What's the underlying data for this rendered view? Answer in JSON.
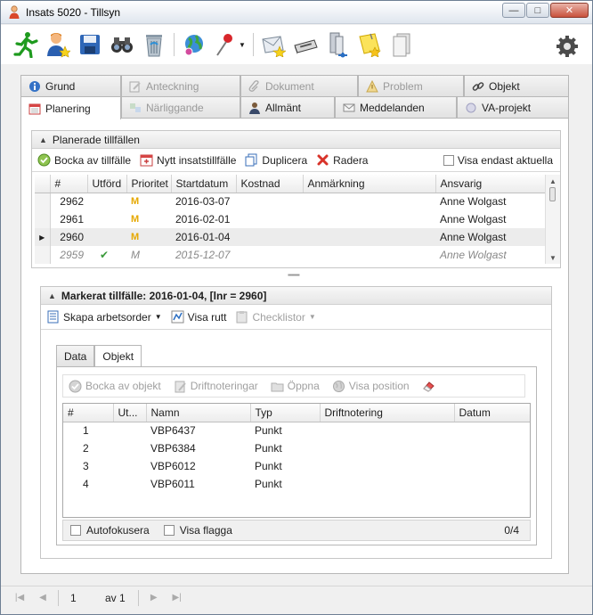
{
  "window": {
    "title": "Insats 5020 - Tillsyn",
    "min": "—",
    "max": "□",
    "close": "✕"
  },
  "tabs_row1": [
    {
      "label": "Grund",
      "enabled": true
    },
    {
      "label": "Anteckning",
      "enabled": false
    },
    {
      "label": "Dokument",
      "enabled": false
    },
    {
      "label": "Problem",
      "enabled": false
    },
    {
      "label": "Objekt",
      "enabled": true
    }
  ],
  "tabs_row2": [
    {
      "label": "Planering",
      "enabled": true,
      "active": true
    },
    {
      "label": "Närliggande",
      "enabled": false
    },
    {
      "label": "Allmänt",
      "enabled": true
    },
    {
      "label": "Meddelanden",
      "enabled": true
    },
    {
      "label": "VA-projekt",
      "enabled": true
    }
  ],
  "planned": {
    "header": "Planerade tillfällen",
    "actions": {
      "tick": "Bocka av tillfälle",
      "new": "Nytt insatstillfälle",
      "duplicate": "Duplicera",
      "delete": "Radera",
      "show_current": "Visa endast aktuella"
    },
    "columns": [
      "#",
      "Utförd",
      "Prioritet",
      "Startdatum",
      "Kostnad",
      "Anmärkning",
      "Ansvarig"
    ],
    "rows": [
      {
        "id": "2962",
        "done": "",
        "prio": "M",
        "start": "2016-03-07",
        "cost": "",
        "note": "",
        "resp": "Anne Wolgast"
      },
      {
        "id": "2961",
        "done": "",
        "prio": "M",
        "start": "2016-02-01",
        "cost": "",
        "note": "",
        "resp": "Anne Wolgast"
      },
      {
        "id": "2960",
        "done": "",
        "prio": "M",
        "start": "2016-01-04",
        "cost": "",
        "note": "",
        "resp": "Anne Wolgast"
      },
      {
        "id": "2959",
        "done": "✔",
        "prio": "M",
        "start": "2015-12-07",
        "cost": "",
        "note": "",
        "resp": "Anne Wolgast"
      }
    ]
  },
  "marked": {
    "header": "Markerat tillfälle: 2016-01-04, [lnr = 2960]",
    "actions": {
      "work_order": "Skapa arbetsorder",
      "show_route": "Visa rutt",
      "checklists": "Checklistor"
    },
    "tabs": [
      "Data",
      "Objekt"
    ],
    "obj_actions": {
      "tick_object": "Bocka av objekt",
      "operation_notes": "Driftnoteringar",
      "open": "Öppna",
      "show_position": "Visa position"
    },
    "columns": [
      "#",
      "Ut...",
      "Namn",
      "Typ",
      "Driftnotering",
      "Datum"
    ],
    "rows": [
      {
        "n": "1",
        "done": "",
        "name": "VBP6437",
        "type": "Punkt",
        "note": "",
        "date": ""
      },
      {
        "n": "2",
        "done": "",
        "name": "VBP6384",
        "type": "Punkt",
        "note": "",
        "date": ""
      },
      {
        "n": "3",
        "done": "",
        "name": "VBP6012",
        "type": "Punkt",
        "note": "",
        "date": ""
      },
      {
        "n": "4",
        "done": "",
        "name": "VBP6011",
        "type": "Punkt",
        "note": "",
        "date": ""
      }
    ],
    "autofocus": "Autofokusera",
    "show_flags": "Visa flagga",
    "count": "0/4"
  },
  "pager": {
    "page": "1",
    "of": "av 1"
  }
}
